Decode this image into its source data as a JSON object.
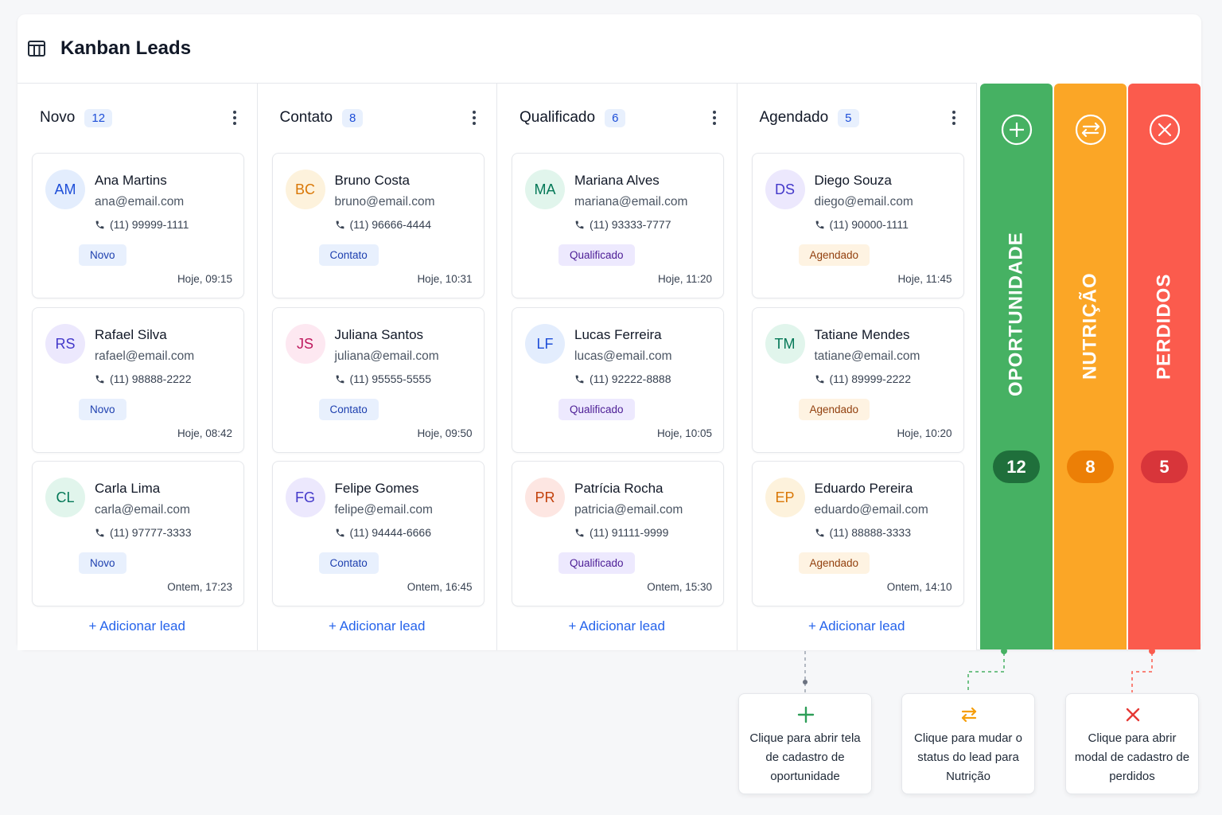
{
  "header": {
    "title": "Kanban Leads",
    "icon": "board-icon"
  },
  "colors": {
    "primary": "#2563eb",
    "green": "#46b163",
    "orange": "#fba626",
    "red": "#fb5b4d"
  },
  "columns": [
    {
      "title": "Novo",
      "count": "12",
      "add_label": "+ Adicionar lead",
      "leads": [
        {
          "initials": "AM",
          "name": "Ana Martins",
          "email": "ana@email.com",
          "phone": "(11) 99999-1111",
          "status": "Novo",
          "time": "Hoje, 09:15"
        },
        {
          "initials": "RS",
          "name": "Rafael Silva",
          "email": "rafael@email.com",
          "phone": "(11) 98888-2222",
          "status": "Novo",
          "time": "Hoje, 08:42"
        },
        {
          "initials": "CL",
          "name": "Carla Lima",
          "email": "carla@email.com",
          "phone": "(11) 97777-3333",
          "status": "Novo",
          "time": "Ontem, 17:23"
        }
      ]
    },
    {
      "title": "Contato",
      "count": "8",
      "add_label": "+ Adicionar lead",
      "leads": [
        {
          "initials": "BC",
          "name": "Bruno Costa",
          "email": "bruno@email.com",
          "phone": "(11) 96666-4444",
          "status": "Contato",
          "time": "Hoje, 10:31"
        },
        {
          "initials": "JS",
          "name": "Juliana Santos",
          "email": "juliana@email.com",
          "phone": "(11) 95555-5555",
          "status": "Contato",
          "time": "Hoje, 09:50"
        },
        {
          "initials": "FG",
          "name": "Felipe Gomes",
          "email": "felipe@email.com",
          "phone": "(11) 94444-6666",
          "status": "Contato",
          "time": "Ontem, 16:45"
        }
      ]
    },
    {
      "title": "Qualificado",
      "count": "6",
      "add_label": "+ Adicionar lead",
      "leads": [
        {
          "initials": "MA",
          "name": "Mariana Alves",
          "email": "mariana@email.com",
          "phone": "(11) 93333-7777",
          "status": "Qualificado",
          "time": "Hoje, 11:20"
        },
        {
          "initials": "LF",
          "name": "Lucas Ferreira",
          "email": "lucas@email.com",
          "phone": "(11) 92222-8888",
          "status": "Qualificado",
          "time": "Hoje, 10:05"
        },
        {
          "initials": "PR",
          "name": "Patrícia Rocha",
          "email": "patricia@email.com",
          "phone": "(11) 91111-9999",
          "status": "Qualificado",
          "time": "Ontem, 15:30"
        }
      ]
    },
    {
      "title": "Agendado",
      "count": "5",
      "add_label": "+ Adicionar lead",
      "leads": [
        {
          "initials": "DS",
          "name": "Diego Souza",
          "email": "diego@email.com",
          "phone": "(11) 90000-1111",
          "status": "Agendado",
          "time": "Hoje, 11:45"
        },
        {
          "initials": "TM",
          "name": "Tatiane Mendes",
          "email": "tatiane@email.com",
          "phone": "(11) 89999-2222",
          "status": "Agendado",
          "time": "Hoje, 10:20"
        },
        {
          "initials": "EP",
          "name": "Eduardo Pereira",
          "email": "eduardo@email.com",
          "phone": "(11) 88888-3333",
          "status": "Agendado",
          "time": "Ontem, 14:10"
        }
      ]
    }
  ],
  "stages": [
    {
      "label": "OPORTUNIDADE",
      "count": "12",
      "icon": "plus-circle-icon",
      "color": "#46b163"
    },
    {
      "label": "NUTRIÇÃO",
      "count": "8",
      "icon": "swap-circle-icon",
      "color": "#fba626"
    },
    {
      "label": "PERDIDOS",
      "count": "5",
      "icon": "x-circle-icon",
      "color": "#fb5b4d"
    }
  ],
  "tooltips": [
    {
      "icon": "plus-icon",
      "text": "Clique para abrir tela de cadastro de oportunidade"
    },
    {
      "icon": "swap-icon",
      "text": "Clique para mudar o status do lead para Nutrição"
    },
    {
      "icon": "x-icon",
      "text": "Clique para abrir modal de cadastro de perdidos"
    }
  ]
}
